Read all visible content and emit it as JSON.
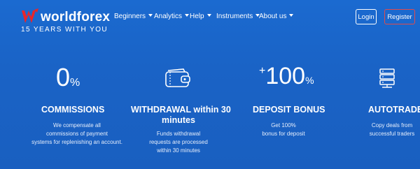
{
  "brand": {
    "name": "worldforex",
    "tagline": "15 YEARS WITH YOU"
  },
  "nav": {
    "items": [
      {
        "label": "Beginners"
      },
      {
        "label": "Analytics"
      },
      {
        "label": "Help"
      },
      {
        "label": "Instruments"
      },
      {
        "label": "About us"
      }
    ]
  },
  "auth": {
    "login": "Login",
    "register": "Register"
  },
  "colors": {
    "background": "#1a66c8",
    "register_border": "#e24b4b",
    "logo_mark": "#e8262b"
  },
  "features": [
    {
      "icon": "percent-icon",
      "stat_number": "0",
      "stat_suffix": "%",
      "title": "COMMISSIONS",
      "desc": [
        "We compensate all",
        "commissions of payment",
        "systems for replenishing an account."
      ]
    },
    {
      "icon": "wallet-icon",
      "title_line1": "WITHDRAWAL within 30",
      "title_line2": "minutes",
      "desc": [
        "Funds withdrawal",
        "requests are processed",
        "within 30 minutes"
      ]
    },
    {
      "icon": "percent-icon",
      "stat_prefix": "+",
      "stat_number": "100",
      "stat_suffix": "%",
      "title": "DEPOSIT BONUS",
      "desc": [
        "Get 100%",
        "bonus for deposit"
      ]
    },
    {
      "icon": "servers-icon",
      "title": "AUTOTRADE",
      "desc": [
        "Copy deals from",
        "successful traders"
      ]
    }
  ]
}
